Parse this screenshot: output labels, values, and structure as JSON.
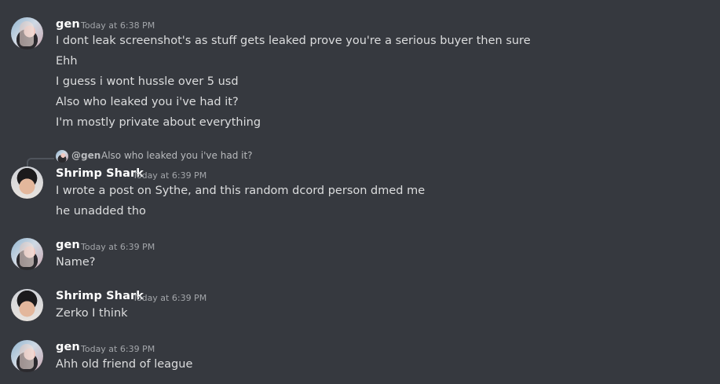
{
  "messages": [
    {
      "author": "gen",
      "timestamp": "Today at 6:38 PM",
      "lines": [
        "I dont leak screenshot's as stuff gets leaked prove you're a serious buyer then sure",
        "Ehh",
        "I guess i wont hussle over 5 usd",
        "Also who leaked you i've had it?",
        "I'm mostly private about everything"
      ]
    },
    {
      "author": "Shrimp Shark",
      "timestamp": "Today at 6:39 PM",
      "reply": {
        "mention": "@gen",
        "text": "Also who leaked you i've had it?"
      },
      "lines": [
        "I wrote a post on Sythe, and this random dcord person dmed me",
        "he unadded tho"
      ]
    },
    {
      "author": "gen",
      "timestamp": "Today at 6:39 PM",
      "lines": [
        "Name?"
      ]
    },
    {
      "author": "Shrimp Shark",
      "timestamp": "Today at 6:39 PM",
      "lines": [
        "Zerko I think"
      ]
    },
    {
      "author": "gen",
      "timestamp": "Today at 6:39 PM",
      "lines": [
        "Ahh old friend of league"
      ]
    }
  ],
  "colors": {
    "background": "#36393f",
    "username": "#ffffff",
    "message_text": "#dcddde",
    "timestamp": "#a3a6aa"
  }
}
